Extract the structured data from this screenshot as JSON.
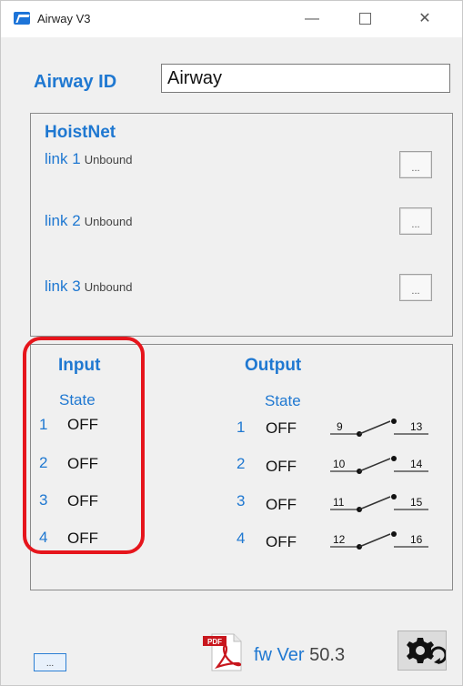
{
  "window": {
    "title": "Airway V3",
    "controls": {
      "minimize": "—",
      "close": "✕"
    }
  },
  "airway_id": {
    "label": "Airway ID",
    "value": "Airway"
  },
  "hoistnet": {
    "title": "HoistNet",
    "links": [
      {
        "label": "link 1",
        "status": "Unbound",
        "button": "..."
      },
      {
        "label": "link 2",
        "status": "Unbound",
        "button": "..."
      },
      {
        "label": "link 3",
        "status": "Unbound",
        "button": "..."
      }
    ]
  },
  "input": {
    "title": "Input",
    "subtitle": "State",
    "rows": [
      {
        "num": "1",
        "state": "OFF"
      },
      {
        "num": "2",
        "state": "OFF"
      },
      {
        "num": "3",
        "state": "OFF"
      },
      {
        "num": "4",
        "state": "OFF"
      }
    ]
  },
  "output": {
    "title": "Output",
    "subtitle": "State",
    "rows": [
      {
        "num": "1",
        "state": "OFF",
        "from": "9",
        "to": "13"
      },
      {
        "num": "2",
        "state": "OFF",
        "from": "10",
        "to": "14"
      },
      {
        "num": "3",
        "state": "OFF",
        "from": "11",
        "to": "15"
      },
      {
        "num": "4",
        "state": "OFF",
        "from": "12",
        "to": "16"
      }
    ]
  },
  "footer": {
    "small_button": "...",
    "pdf_badge": "PDF",
    "fw_prefix": "fw Ver",
    "fw_version": "50.3",
    "icons": {
      "pdf": "pdf-icon",
      "settings": "gear-icon"
    }
  },
  "colors": {
    "accent": "#1f78d1",
    "highlight": "#e6151c"
  }
}
